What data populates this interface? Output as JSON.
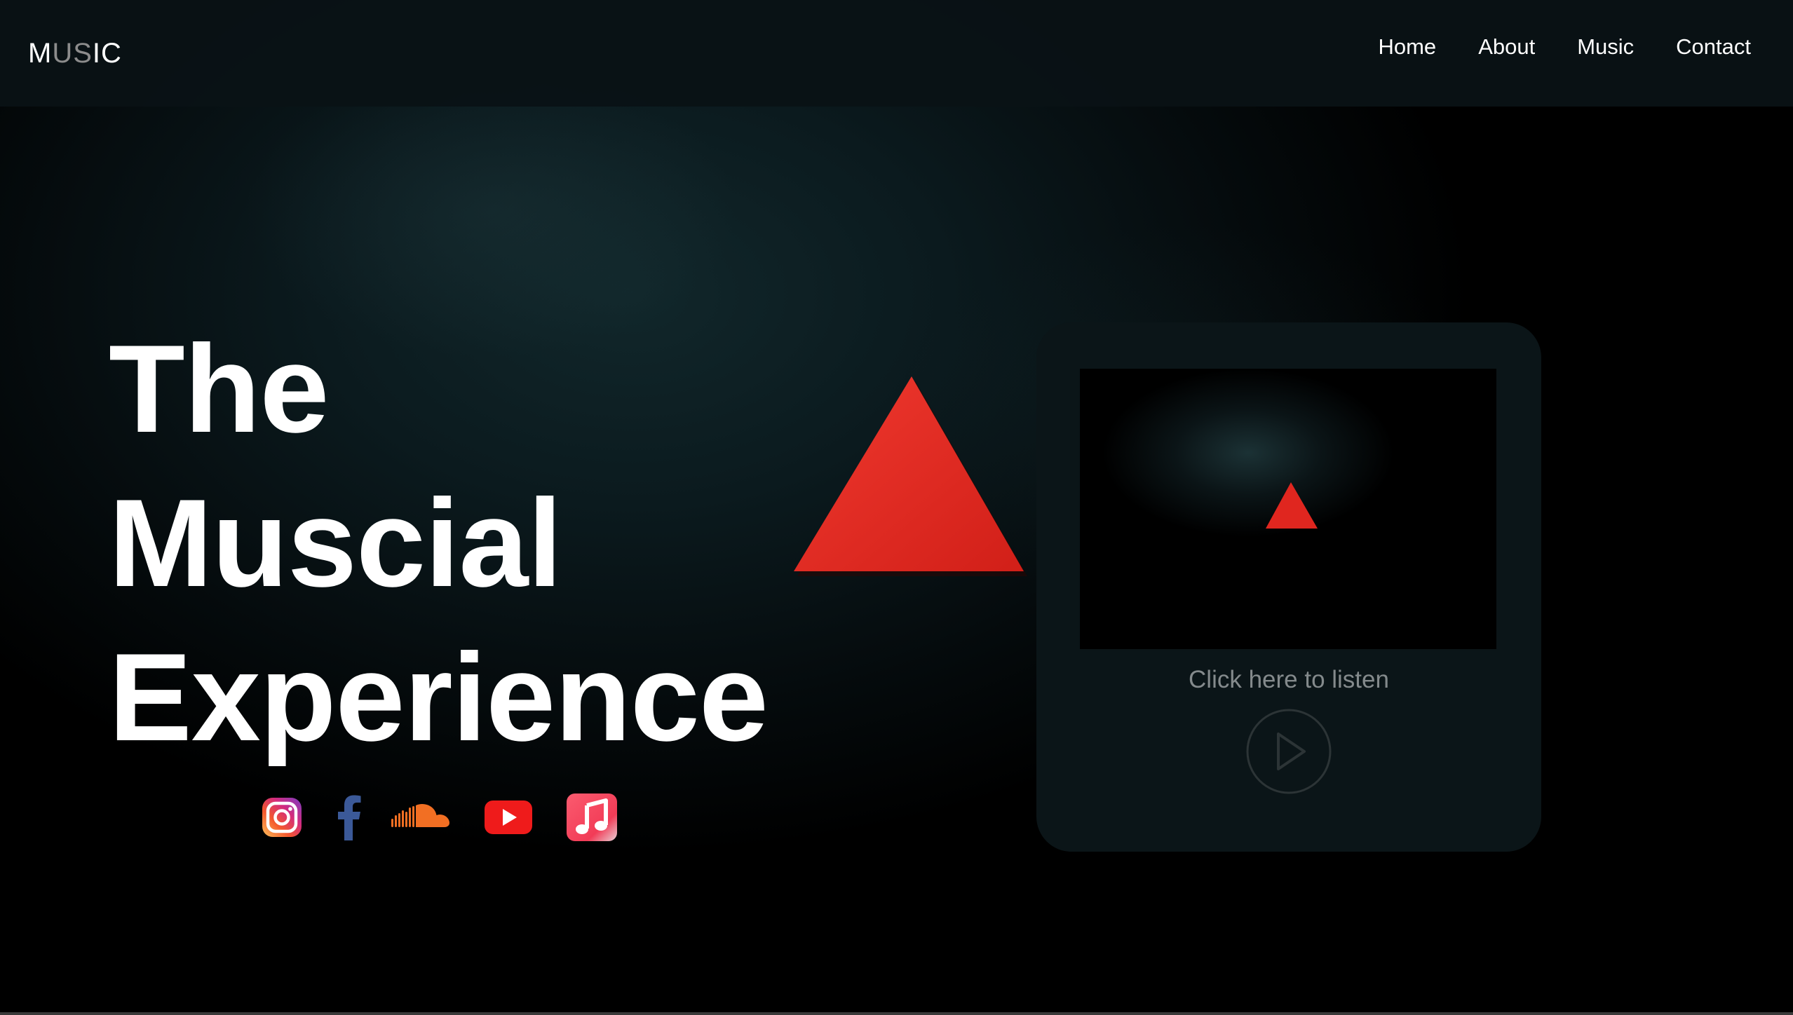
{
  "header": {
    "logo": {
      "part1": "M",
      "part2": "US",
      "part3": "IC"
    },
    "nav": [
      {
        "label": "Home"
      },
      {
        "label": "About"
      },
      {
        "label": "Music"
      },
      {
        "label": "Contact"
      }
    ]
  },
  "hero": {
    "title_lines": [
      "The",
      "Muscial",
      "Experience"
    ],
    "socials": [
      {
        "icon": "instagram-icon"
      },
      {
        "icon": "facebook-icon"
      },
      {
        "icon": "soundcloud-icon"
      },
      {
        "icon": "youtube-icon"
      },
      {
        "icon": "apple-music-icon"
      }
    ]
  },
  "player": {
    "listen_label": "Click here to listen",
    "play_icon": "play-icon"
  },
  "colors": {
    "accent_red": "#e0261f",
    "background": "#000000",
    "text": "#ffffff",
    "muted_text": "#848a8c"
  }
}
